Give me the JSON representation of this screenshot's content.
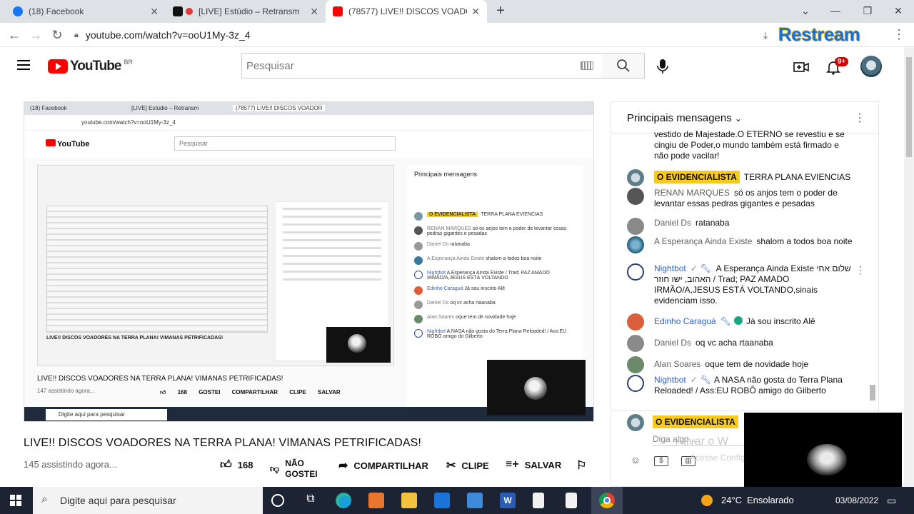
{
  "browser": {
    "tabs": [
      {
        "title": "(18) Facebook",
        "color": "#1877f2"
      },
      {
        "title": "[LIVE] Estúdio – Retransm",
        "color": "#e53935"
      },
      {
        "title": "(78577) LIVE!! DISCOS VOADOR",
        "color": "#ff0000"
      }
    ],
    "url": "youtube.com/watch?v=ooU1My-3z_4",
    "extension_label": "Restream"
  },
  "yt": {
    "logo_text": "YouTube",
    "country": "BR",
    "search_placeholder": "Pesquisar",
    "notification_count": "9+"
  },
  "video": {
    "title": "LIVE!! DISCOS VOADORES NA TERRA PLANA! VIMANAS PETRIFICADAS!",
    "viewers": "145 assistindo agora...",
    "likes": "168",
    "dislike_label_1": "NÃO",
    "dislike_label_2": "GOSTEI",
    "share": "COMPARTILHAR",
    "clip": "CLIPE",
    "save": "SALVAR"
  },
  "nested": {
    "tabs": [
      "(18) Facebook",
      "[LIVE] Estúdio – Retransm",
      "(78577) LIVE!! DISCOS VOADOR"
    ],
    "url": "youtube.com/watch?v=ooU1My-3z_4",
    "search": "Pesquisar",
    "chat_header": "Principais mensagens",
    "title": "LIVE!! DISCOS VOADORES NA TERRA PLANA! VIMANAS PETRIFICADAS!",
    "viewers": "147 assistindo agora...",
    "likes": "168",
    "taskbar_search": "Digite aqui para pesquisar",
    "rows": [
      {
        "author": "O EVIDENCIALISTA",
        "text": "TERRA PLANA EVIENCIAS",
        "chip": true
      },
      {
        "author": "RENAN MARQUES",
        "text": "só os anjos tem o poder de levantar essas pedras gigantes e pesadas"
      },
      {
        "author": "Daniel Ds",
        "text": "ratanaba"
      },
      {
        "author": "A Esperança Ainda Existe",
        "text": "shalom a todos boa noite"
      },
      {
        "author": "Nightbot",
        "text": "A Esperança Ainda Existe / Trad; PAZ AMADO IRMÃO/A,JESUS ESTÁ VOLTANDO"
      },
      {
        "author": "Edinho Caraguá",
        "text": "Já sou inscrito Alê"
      },
      {
        "author": "Daniel Ds",
        "text": "oq vc acha rtaanaba"
      },
      {
        "author": "Alan Soares",
        "text": "oque tem de novidade hoje"
      },
      {
        "author": "Nightbot",
        "text": "A NASA não gosta do Terra Plana Reloaded! / Ass:EU ROBÔ amigo do Gilberto"
      }
    ]
  },
  "chat": {
    "header": "Principais mensagens",
    "partial_text": "vestido de Majestade.O ETERNO se revestiu e se cingiu de Poder,o mundo também está firmado e não pode vacilar!",
    "messages": [
      {
        "author": "O EVIDENCIALISTA",
        "text": "TERRA PLANA EVIENCIAS"
      },
      {
        "author": "RENAN MARQUES",
        "text": "só os anjos tem o poder de levantar essas pedras gigantes e pesadas"
      },
      {
        "author": "Daniel Ds",
        "text": "ratanaba"
      },
      {
        "author": "A Esperança Ainda Existe",
        "text": "shalom a todos boa noite"
      },
      {
        "author": "Nightbot",
        "text_1": "A Esperança Ainda Existe שלום אחי",
        "text_2": "האהוב, ישו חוזר / Trad; PAZ AMADO",
        "text_3": "IRMÃO/A,JESUS ESTÁ VOLTANDO,sinais",
        "text_4": "evidenciam isso."
      },
      {
        "author": "Edinho Caraguá",
        "text": "Já sou inscrito Alê"
      },
      {
        "author": "Daniel Ds",
        "text": "oq vc acha rtaanaba"
      },
      {
        "author": "Alan Soares",
        "text": "oque tem de novidade hoje"
      },
      {
        "author": "Nightbot",
        "text": "A NASA não gosta do Terra Plana Reloaded! / Ass:EU ROBÔ amigo do Gilberto"
      }
    ],
    "pinned_author": "O EVIDENCIALISTA",
    "input_placeholder": "Diga algo...",
    "watermark_1": "Ativar o W",
    "watermark_2": "Acesse Configu"
  },
  "taskbar": {
    "search_placeholder": "Digite aqui para pesquisar",
    "temperature": "24°C",
    "weather": "Ensolarado",
    "date": "03/08/2022"
  },
  "colors": {
    "yt_red": "#ff0000",
    "chip_yellow": "#f8c91e",
    "link_blue": "#2962d3"
  }
}
